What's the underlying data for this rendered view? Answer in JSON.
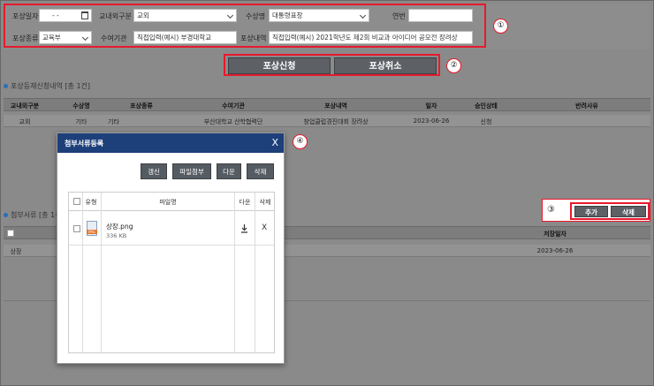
{
  "form": {
    "award_date_label": "포상일자",
    "award_date_value": "- -",
    "inout_label": "교내외구분",
    "inout_value": "교외",
    "award_name_label": "수상명",
    "award_name_value": "대통령표창",
    "serial_label": "연번",
    "serial_value": "",
    "award_type_label": "포상종류",
    "award_type_value": "교육부",
    "agency_label": "수여기관",
    "agency_value": "직접입력(예시) 부경대학교",
    "details_label": "포상내역",
    "details_value": "직접입력(예시) 2021학년도 제2회 비교과 아이디어 공모전 장려상"
  },
  "actions": {
    "apply_label": "포상신청",
    "cancel_label": "포상취소"
  },
  "markers": [
    "①",
    "②",
    "③",
    "④"
  ],
  "application_section": {
    "title": "포상등재신청내역 [총 1건]",
    "columns": [
      "교내외구분",
      "수상명",
      "포상종류",
      "수여기관",
      "포상내역",
      "일자",
      "승인상태",
      "반려사유"
    ],
    "rows": [
      [
        "교외",
        "기타",
        "기타",
        "부산대학교 산학협력단",
        "창업클럽경진대회 장려상",
        "2023-06-26",
        "신청",
        ""
      ]
    ]
  },
  "attachment_section": {
    "title": "첨부서류 [총 1건]",
    "add_label": "추가",
    "delete_label": "삭제",
    "date_column": "저장일자",
    "rows": [
      {
        "name": "상장",
        "date": "2023-06-26"
      }
    ]
  },
  "modal": {
    "title": "첨부서류등록",
    "close": "X",
    "buttons": [
      "갱신",
      "파일첨부",
      "다운",
      "삭제"
    ],
    "columns": [
      "유형",
      "파일명",
      "다운",
      "삭제"
    ],
    "file": {
      "type_badge": "IMG",
      "name": "상장.png",
      "size": "336 KB",
      "delete": "X"
    }
  },
  "colors": {
    "accent_red": "#e8192c",
    "modal_header": "#1d3f7a",
    "button_gray": "#5d6166"
  }
}
